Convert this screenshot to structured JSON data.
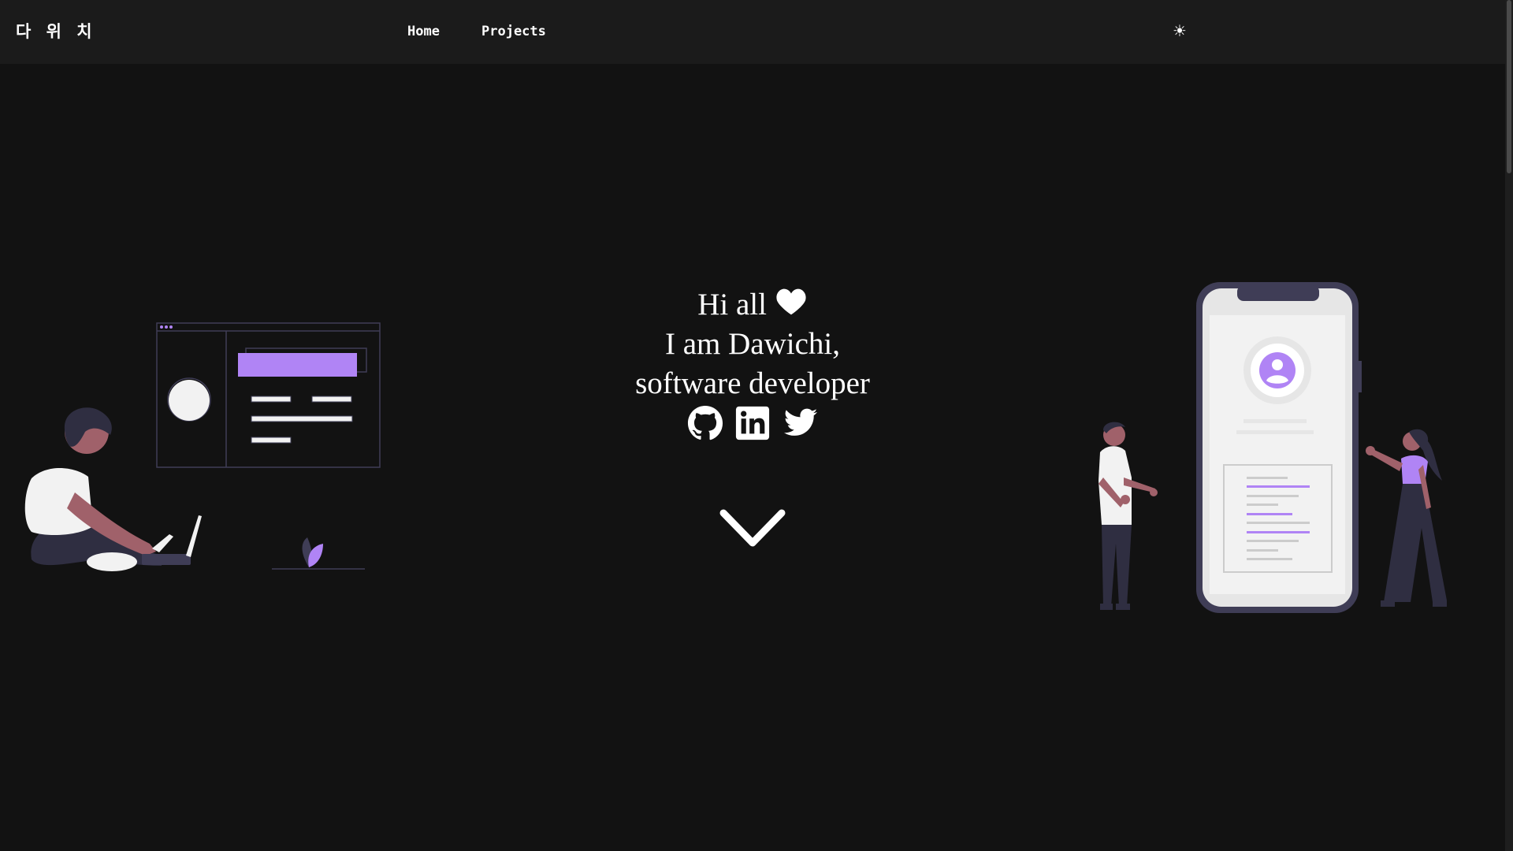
{
  "navbar": {
    "logo": "다 위 치",
    "links": [
      {
        "label": "Home"
      },
      {
        "label": "Projects"
      }
    ],
    "theme_toggle": "☀"
  },
  "hero": {
    "line1": "Hi all",
    "line2": "I am Dawichi,",
    "line3": "software developer",
    "heart_icon": "heart-icon"
  },
  "socials": [
    {
      "name": "github",
      "icon": "github-icon"
    },
    {
      "name": "linkedin",
      "icon": "linkedin-icon"
    },
    {
      "name": "twitter",
      "icon": "twitter-icon"
    }
  ],
  "scroll_icon": "chevron-down-icon",
  "colors": {
    "background": "#121212",
    "navbar": "#1b1b1b",
    "accent": "#b084f5",
    "text": "#ffffff"
  }
}
